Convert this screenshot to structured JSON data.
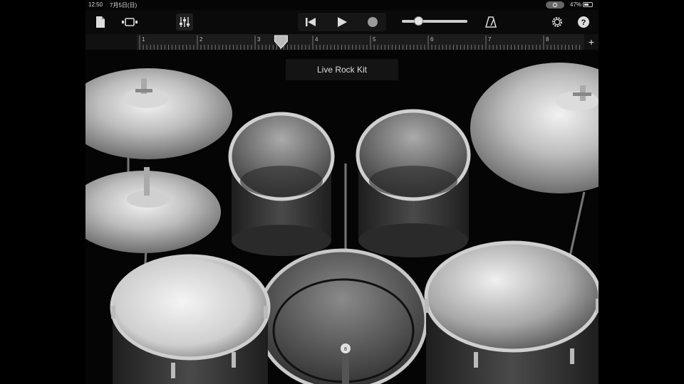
{
  "status_bar": {
    "time": "12:50",
    "date": "7月5日(日)",
    "battery_percent": "47%",
    "battery_level": 0.47
  },
  "control_bar": {
    "icons": {
      "my_songs": "document-icon",
      "view_toggle": "view-toggle-icon",
      "mixer": "mixer-sliders-icon",
      "rewind": "rewind-to-start-icon",
      "play": "play-icon",
      "record": "record-icon",
      "metronome": "metronome-icon",
      "settings": "gear-icon",
      "help": "help-icon"
    },
    "master_volume_level": 0.25,
    "help_glyph": "?"
  },
  "ruler": {
    "bars": [
      "1",
      "2",
      "3",
      "4",
      "5",
      "6",
      "7",
      "8"
    ],
    "add_section_glyph": "+",
    "playhead_bar": 3.45
  },
  "instrument": {
    "name": "Live Rock Kit",
    "kick_pedal_number": "8"
  },
  "colors": {
    "background": "#050505",
    "panel": "#0a0a0a",
    "ruler": "#1c1c1c",
    "label_bg": "#141414",
    "icon": "#dddddd",
    "chrome": "#c8c8c8",
    "drum_shell": "#3a3a3a"
  }
}
